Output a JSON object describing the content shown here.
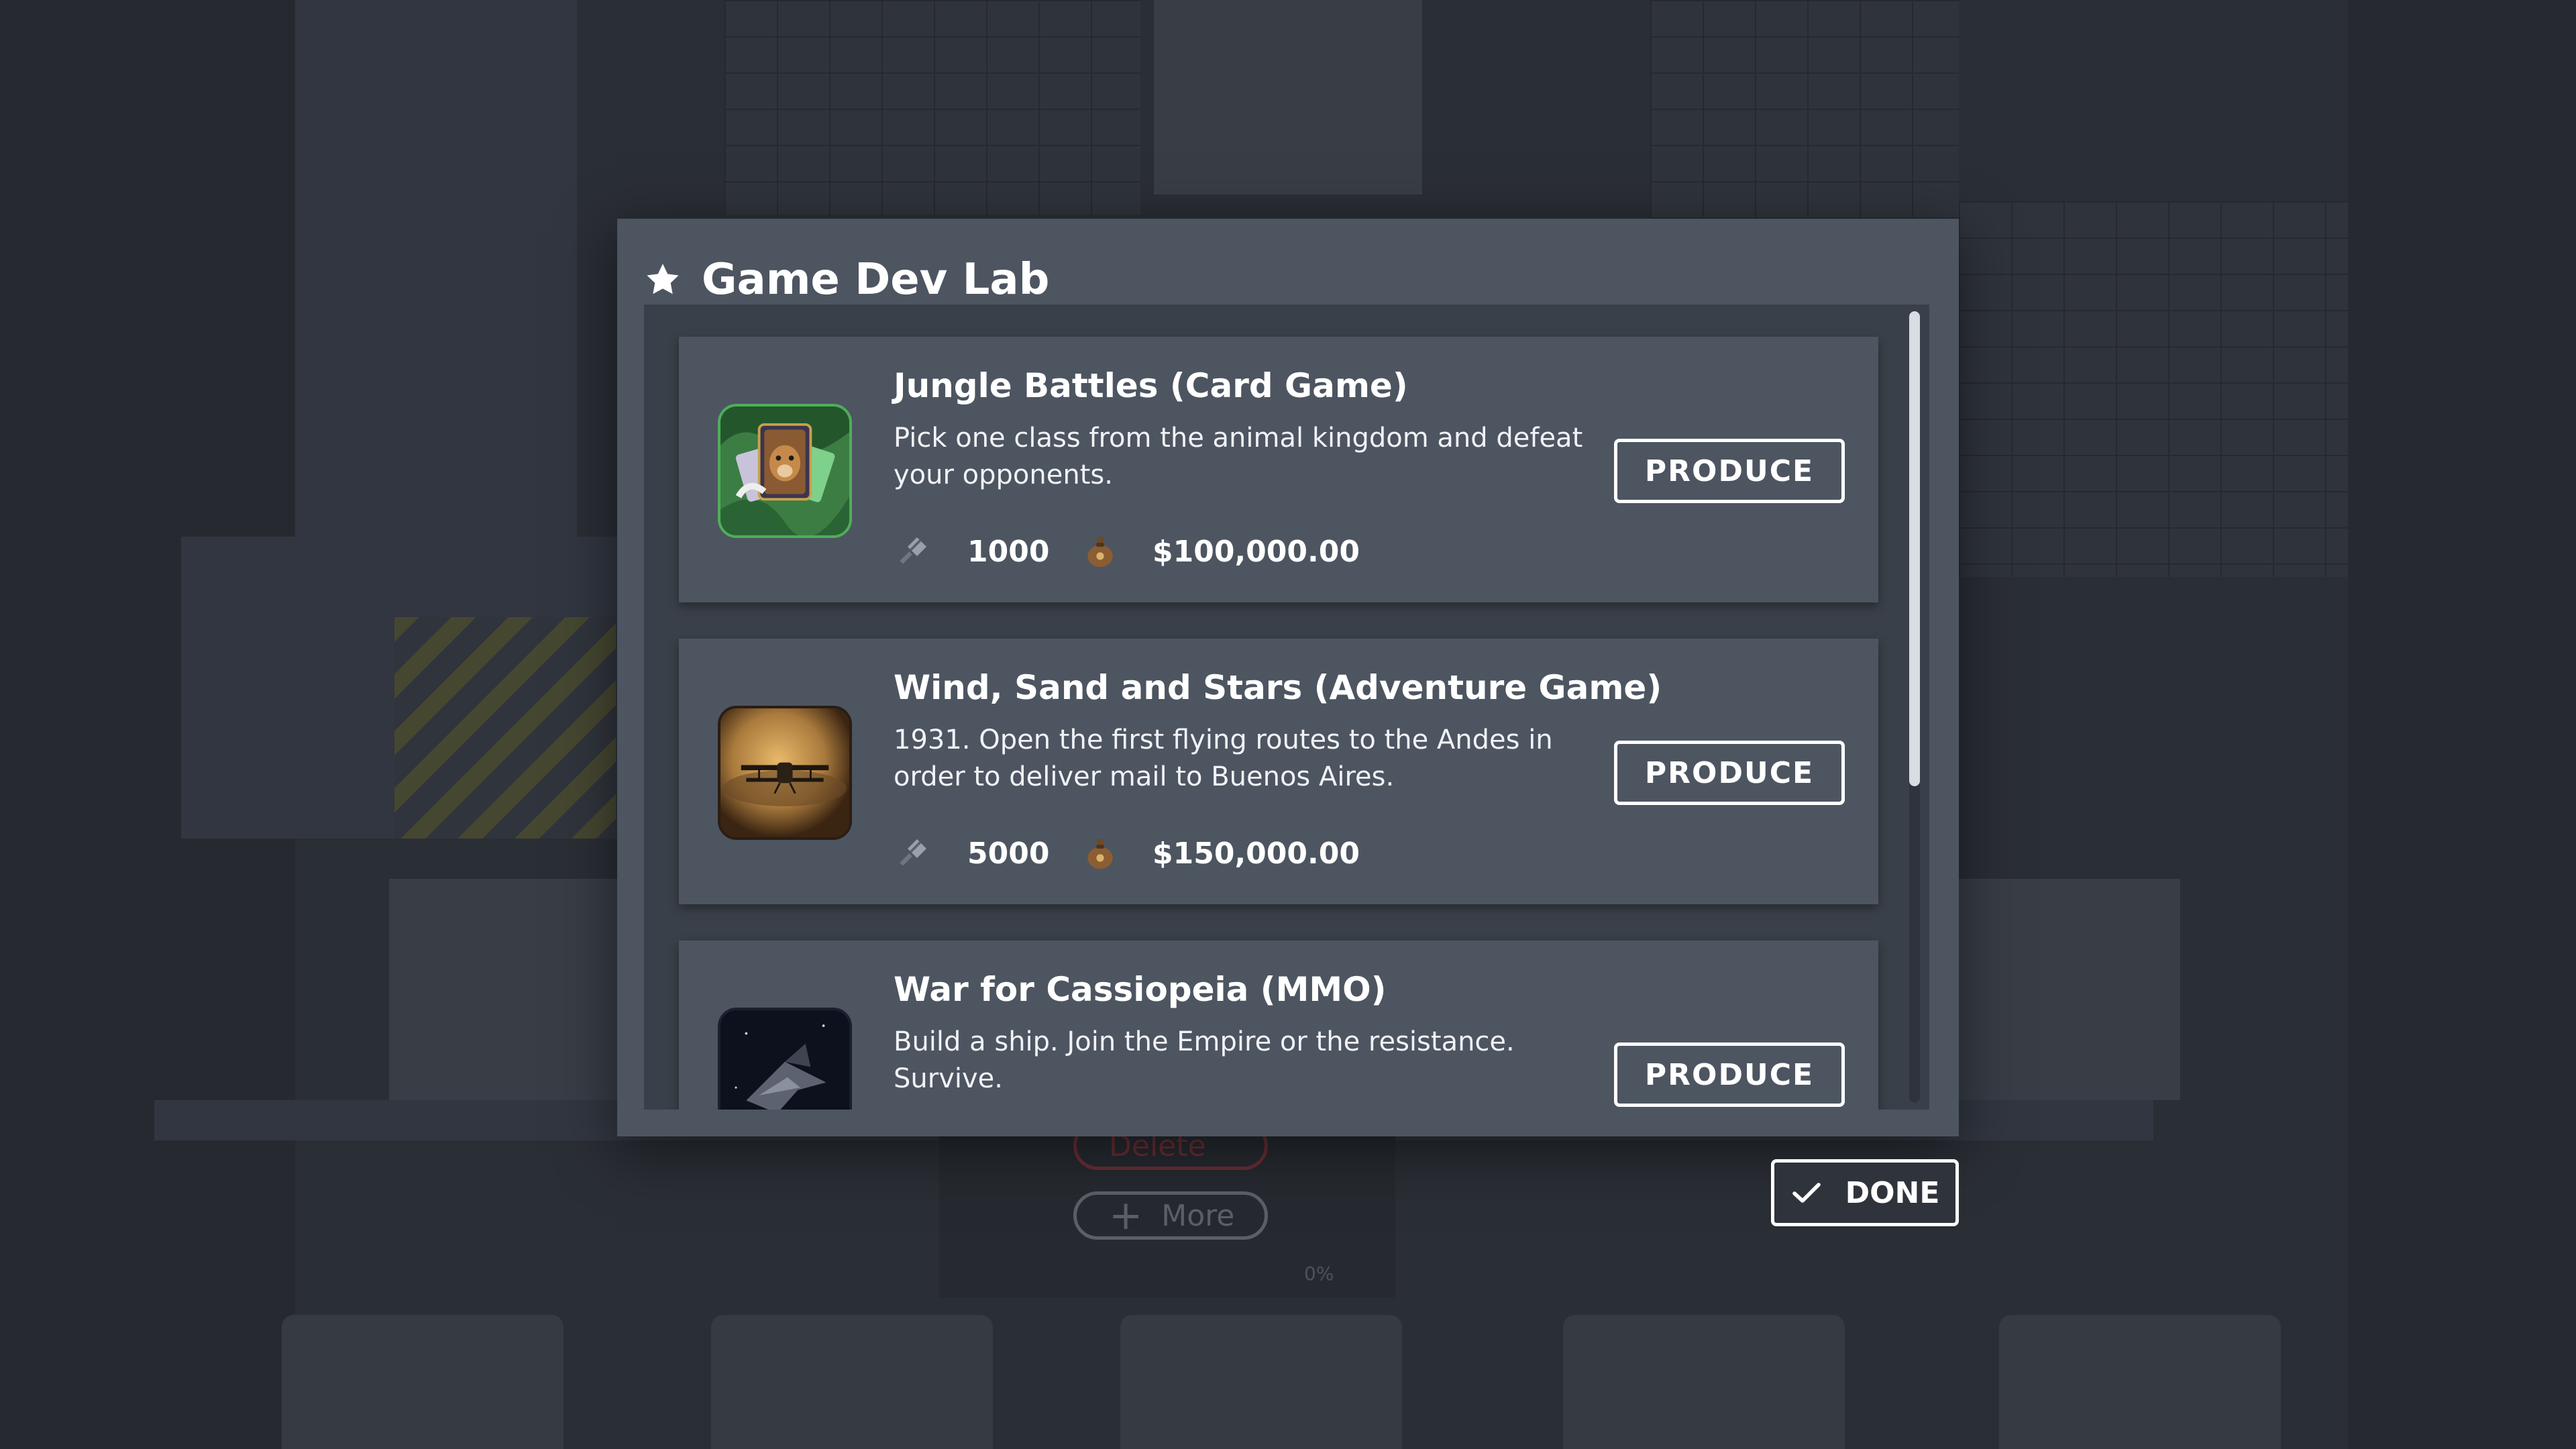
{
  "dialog": {
    "title": "Game Dev Lab",
    "icon": "star-icon"
  },
  "games": [
    {
      "name": "Jungle Battles (Card Game)",
      "description": "Pick one class from the animal kingdom and defeat your opponents.",
      "units": "1000",
      "cost": "$100,000.00",
      "thumbnail": "card-game-thumbnail",
      "button": "PRODUCE"
    },
    {
      "name": "Wind, Sand and Stars (Adventure Game)",
      "description": "1931. Open the first flying routes to the Andes in order to deliver mail to Buenos Aires.",
      "units": "5000",
      "cost": "$150,000.00",
      "thumbnail": "biplane-thumbnail",
      "button": "PRODUCE"
    },
    {
      "name": "War for Cassiopeia (MMO)",
      "description": "Build a ship. Join the Empire or the resistance. Survive.",
      "thumbnail": "spaceship-thumbnail",
      "button": "PRODUCE"
    }
  ],
  "stat_icons": {
    "units": "tool-icon",
    "cost": "money-bag-icon"
  },
  "done_label": "DONE",
  "background": {
    "more_label": "More",
    "delete_label": "Delete",
    "progress": "0%"
  },
  "scroll": {
    "thumb_fraction": 0.6
  },
  "colors": {
    "dialog": "#4d5561",
    "list": "#3a4049",
    "card": "#4d5561",
    "accent": "#ffffff"
  }
}
